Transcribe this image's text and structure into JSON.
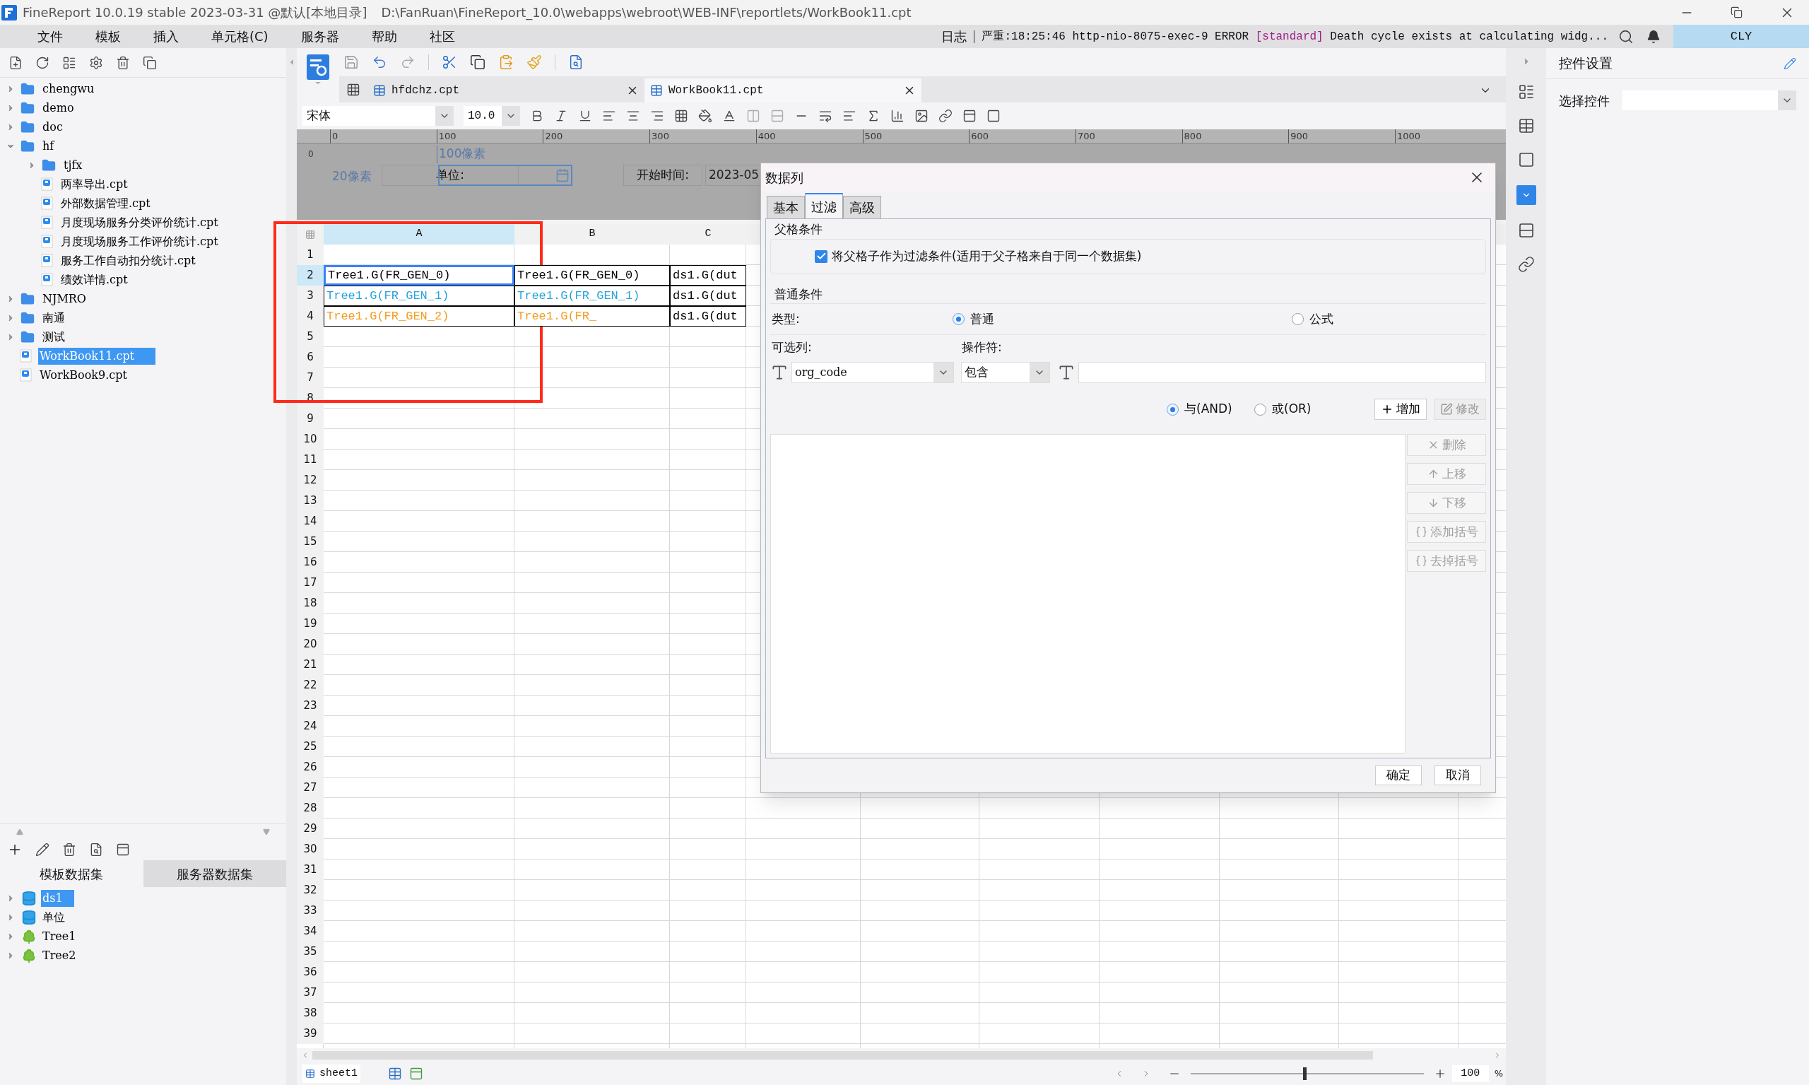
{
  "title_bar": {
    "app": "FineReport 10.0.19 stable 2023-03-31 @默认[本地目录]",
    "path": "D:\\FanRuan\\FineReport_10.0\\webapps\\webroot\\WEB-INF\\reportlets/WorkBook11.cpt"
  },
  "menu": [
    "文件",
    "模板",
    "插入",
    "单元格(C)",
    "服务器",
    "帮助",
    "社区"
  ],
  "log": {
    "label": "日志",
    "level": "严重:18:25:46 http-nio-8075-exec-9 ERROR",
    "tag": "[standard]",
    "text": "Death cycle exists at calculating widg..."
  },
  "user": "CLY",
  "file_tree": [
    {
      "name": "chengwu",
      "kind": "folder",
      "expanded": false,
      "selected": false
    },
    {
      "name": "demo",
      "kind": "folder",
      "expanded": false,
      "selected": false
    },
    {
      "name": "doc",
      "kind": "folder",
      "expanded": false,
      "selected": false
    },
    {
      "name": "hf",
      "kind": "folder",
      "expanded": true,
      "selected": false,
      "children": [
        {
          "name": "tjfx",
          "kind": "folder",
          "expanded": false,
          "selected": false
        },
        {
          "name": "两率导出.cpt",
          "kind": "report",
          "selected": false
        },
        {
          "name": "外部数据管理.cpt",
          "kind": "report",
          "selected": false
        },
        {
          "name": "月度现场服务分类评价统计.cpt",
          "kind": "report",
          "selected": false
        },
        {
          "name": "月度现场服务工作评价统计.cpt",
          "kind": "report",
          "selected": false
        },
        {
          "name": "服务工作自动扣分统计.cpt",
          "kind": "report",
          "selected": false
        },
        {
          "name": "绩效详情.cpt",
          "kind": "report",
          "selected": false
        }
      ]
    },
    {
      "name": "NJMRO",
      "kind": "folder",
      "expanded": false,
      "selected": false
    },
    {
      "name": "南通",
      "kind": "folder",
      "expanded": false,
      "selected": false
    },
    {
      "name": "测试",
      "kind": "folder",
      "expanded": false,
      "selected": false
    },
    {
      "name": "WorkBook11.cpt",
      "kind": "report",
      "selected": true
    },
    {
      "name": "WorkBook9.cpt",
      "kind": "report",
      "selected": false
    }
  ],
  "dataset_tabs": [
    {
      "label": "模板数据集",
      "selected": true
    },
    {
      "label": "服务器数据集",
      "selected": false
    }
  ],
  "datasets": [
    {
      "name": "ds1",
      "kind": "table",
      "selected": true
    },
    {
      "name": "单位",
      "kind": "table",
      "selected": false
    },
    {
      "name": "Tree1",
      "kind": "tree",
      "selected": false
    },
    {
      "name": "Tree2",
      "kind": "tree",
      "selected": false
    }
  ],
  "editor_tabs": [
    {
      "label": "hfdchz.cpt",
      "selected": false
    },
    {
      "label": "WorkBook11.cpt",
      "selected": true
    }
  ],
  "format": {
    "font": "宋体",
    "size": "10.0"
  },
  "ruler": [
    "0",
    "100",
    "200",
    "300",
    "400",
    "500",
    "600",
    "700",
    "800",
    "900",
    "1000"
  ],
  "ruler_side": "0",
  "parameters": {
    "dim_width": "100像素",
    "dim_height": "20像素",
    "unit_label": "单位:",
    "start_label": "开始时间:",
    "start_value": "2023-05"
  },
  "grid": {
    "columns": [
      {
        "label": "A",
        "selected": true
      },
      {
        "label": "B",
        "selected": false
      },
      {
        "label": "C",
        "selected": false
      }
    ],
    "rows": [
      {
        "label": "1",
        "selected": false
      },
      {
        "label": "2",
        "selected": true,
        "a": {
          "text": "Tree1.G(FR_GEN_0)",
          "color": "#000000",
          "selected": true
        },
        "b": {
          "text": "Tree1.G(FR_GEN_0)",
          "color": "#000000",
          "selected": false
        },
        "c": {
          "text": "ds1.G(dut",
          "color": "#000000",
          "selected": false
        }
      },
      {
        "label": "3",
        "selected": false,
        "a": {
          "text": "Tree1.G(FR_GEN_1)",
          "color": "#29a3db",
          "selected": false
        },
        "b": {
          "text": "Tree1.G(FR_GEN_1)",
          "color": "#29a3db",
          "selected": false
        },
        "c": {
          "text": "ds1.G(dut",
          "color": "#000000",
          "selected": false
        }
      },
      {
        "label": "4",
        "selected": false,
        "a": {
          "text": "Tree1.G(FR_GEN_2)",
          "color": "#f39c1f",
          "selected": false
        },
        "b": {
          "text": "Tree1.G(FR_",
          "color": "#f39c1f",
          "selected": false
        },
        "c": {
          "text": "ds1.G(dut",
          "color": "#000000",
          "selected": false
        }
      },
      {
        "label": "5",
        "selected": false
      },
      {
        "label": "6",
        "selected": false
      },
      {
        "label": "7",
        "selected": false
      },
      {
        "label": "8",
        "selected": false
      },
      {
        "label": "9",
        "selected": false
      },
      {
        "label": "10",
        "selected": false
      },
      {
        "label": "11",
        "selected": false
      },
      {
        "label": "12",
        "selected": false
      },
      {
        "label": "13",
        "selected": false
      },
      {
        "label": "14",
        "selected": false
      },
      {
        "label": "15",
        "selected": false
      },
      {
        "label": "16",
        "selected": false
      },
      {
        "label": "17",
        "selected": false
      },
      {
        "label": "18",
        "selected": false
      },
      {
        "label": "19",
        "selected": false
      },
      {
        "label": "20",
        "selected": false
      },
      {
        "label": "21",
        "selected": false
      },
      {
        "label": "22",
        "selected": false
      },
      {
        "label": "23",
        "selected": false
      },
      {
        "label": "24",
        "selected": false
      },
      {
        "label": "25",
        "selected": false
      },
      {
        "label": "26",
        "selected": false
      },
      {
        "label": "27",
        "selected": false
      },
      {
        "label": "28",
        "selected": false
      },
      {
        "label": "29",
        "selected": false
      },
      {
        "label": "30",
        "selected": false
      },
      {
        "label": "31",
        "selected": false
      },
      {
        "label": "32",
        "selected": false
      },
      {
        "label": "33",
        "selected": false
      },
      {
        "label": "34",
        "selected": false
      },
      {
        "label": "35",
        "selected": false
      },
      {
        "label": "36",
        "selected": false
      },
      {
        "label": "37",
        "selected": false
      },
      {
        "label": "38",
        "selected": false
      },
      {
        "label": "39",
        "selected": false
      }
    ]
  },
  "sheet": {
    "tab": "sheet1",
    "zoom": "100",
    "zoom_unit": "%",
    "level": 0.49
  },
  "dialog": {
    "title": "数据列",
    "tabs": [
      {
        "label": "基本",
        "selected": false
      },
      {
        "label": "过滤",
        "selected": true
      },
      {
        "label": "高级",
        "selected": false
      }
    ],
    "parent_group": "父格条件",
    "parent_check": {
      "label": "将父格子作为过滤条件(适用于父子格来自于同一个数据集)",
      "checked": true
    },
    "normal_group": "普通条件",
    "type_label": "类型:",
    "types": [
      {
        "label": "普通",
        "selected": true
      },
      {
        "label": "公式",
        "selected": false
      }
    ],
    "column_label": "可选列:",
    "operator_label": "操作符:",
    "column_value": "org_code",
    "operator_value": "包含",
    "joins": [
      {
        "label": "与(AND)",
        "selected": true
      },
      {
        "label": "或(OR)",
        "selected": false
      }
    ],
    "top_buttons": [
      {
        "label": "增加",
        "disabled": false
      },
      {
        "label": "修改",
        "disabled": true
      }
    ],
    "side_buttons": [
      {
        "label": "删除",
        "disabled": true
      },
      {
        "label": "上移",
        "disabled": true
      },
      {
        "label": "下移",
        "disabled": true
      },
      {
        "label": "添加括号",
        "disabled": true
      },
      {
        "label": "去掉括号",
        "disabled": true
      }
    ],
    "ok": "确定",
    "cancel": "取消"
  },
  "properties": {
    "title": "控件设置",
    "select_label": "选择控件"
  }
}
